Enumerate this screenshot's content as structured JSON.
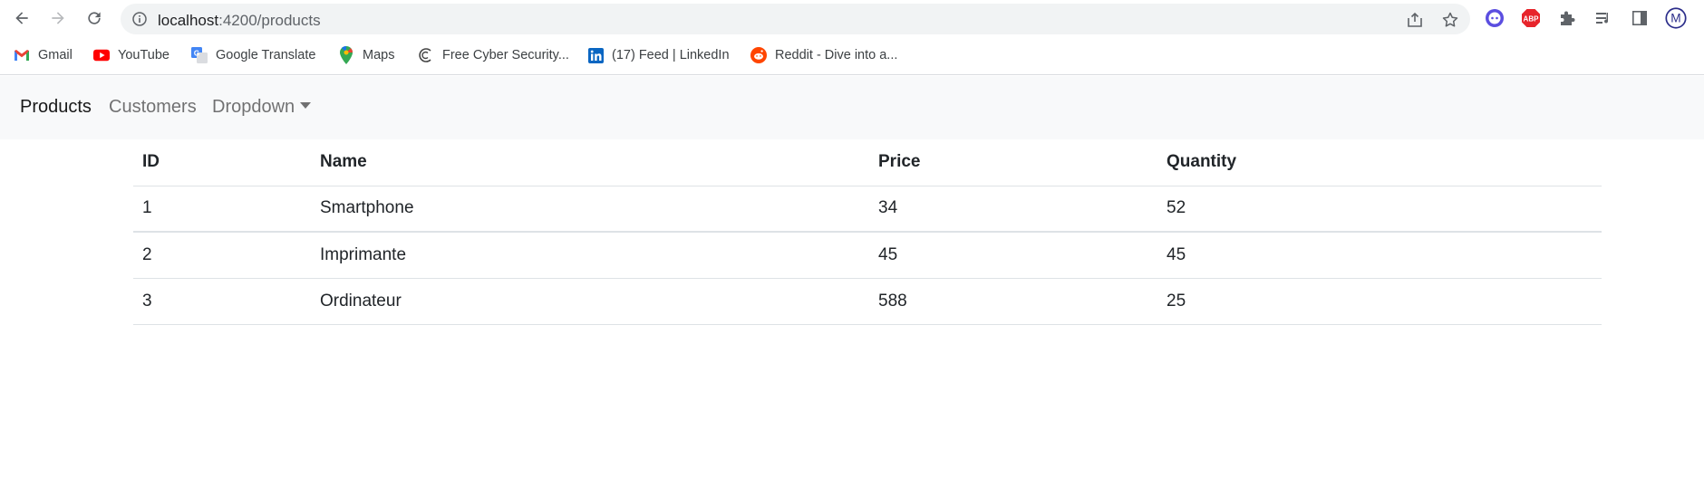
{
  "browser": {
    "url_host": "localhost",
    "url_rest": ":4200/products",
    "bookmarks": [
      {
        "label": "Gmail",
        "icon": "gmail-icon"
      },
      {
        "label": "YouTube",
        "icon": "youtube-icon"
      },
      {
        "label": "Google Translate",
        "icon": "translate-icon"
      },
      {
        "label": "Maps",
        "icon": "maps-icon"
      },
      {
        "label": "Free Cyber Security...",
        "icon": "cyber-icon"
      },
      {
        "label": "(17) Feed | LinkedIn",
        "icon": "linkedin-icon"
      },
      {
        "label": "Reddit - Dive into a...",
        "icon": "reddit-icon"
      }
    ],
    "abp_label": "ABP",
    "profile_initial": "M"
  },
  "nav": {
    "brand": "Products",
    "links": [
      "Customers",
      "Dropdown"
    ]
  },
  "table": {
    "headers": [
      "ID",
      "Name",
      "Price",
      "Quantity"
    ],
    "rows": [
      [
        "1",
        "Smartphone",
        "34",
        "52"
      ],
      [
        "2",
        "Imprimante",
        "45",
        "45"
      ],
      [
        "3",
        "Ordinateur",
        "588",
        "25"
      ]
    ]
  },
  "colors": {
    "navbar_bg": "#f8f9fa",
    "omnibox_bg": "#f1f3f4"
  }
}
